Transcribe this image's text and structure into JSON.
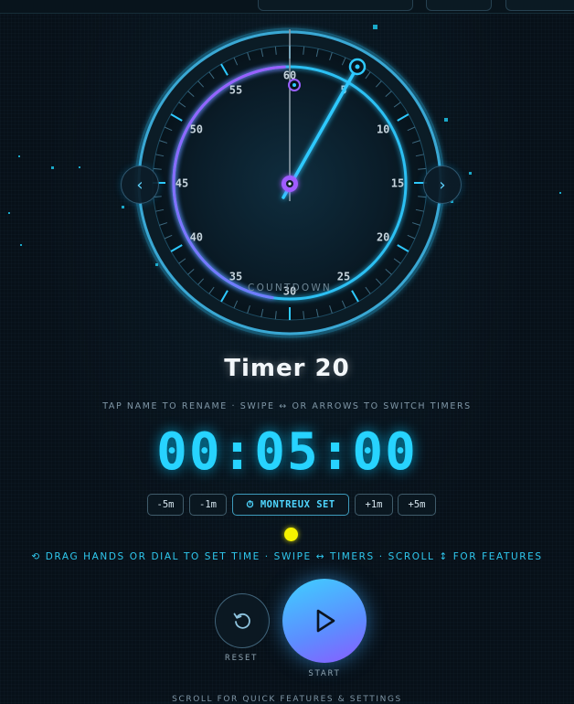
{
  "dial": {
    "numbers": [
      "60",
      "5",
      "10",
      "15",
      "20",
      "25",
      "30",
      "35",
      "40",
      "45",
      "50",
      "55"
    ],
    "mode_label": "COUNTDOWN",
    "set_minutes": 5,
    "colors": {
      "ring_cyan": "#2ec9ff",
      "ring_purple": "#8a5cff",
      "hand": "#2ec9ff"
    }
  },
  "nav": {
    "prev_icon": "chevron-left-icon",
    "next_icon": "chevron-right-icon",
    "prev_label": "‹",
    "next_label": "›"
  },
  "timer": {
    "name": "Timer 20",
    "time": "00:05:00"
  },
  "hints": {
    "rename": "TAP NAME TO RENAME · SWIPE ↔ OR ARROWS TO SWITCH TIMERS",
    "controls": "⟲ DRAG HANDS OR DIAL TO SET TIME · SWIPE ↔ TIMERS · SCROLL ↕ FOR FEATURES",
    "bottom": "SCROLL FOR QUICK FEATURES & SETTINGS"
  },
  "adjust": {
    "minus5": "-5m",
    "minus1": "-1m",
    "preset": "⏱ MONTREUX SET",
    "plus1": "+1m",
    "plus5": "+5m"
  },
  "actions": {
    "reset_label": "RESET",
    "start_label": "START",
    "reset_icon": "reset-icon",
    "start_icon": "play-icon"
  }
}
